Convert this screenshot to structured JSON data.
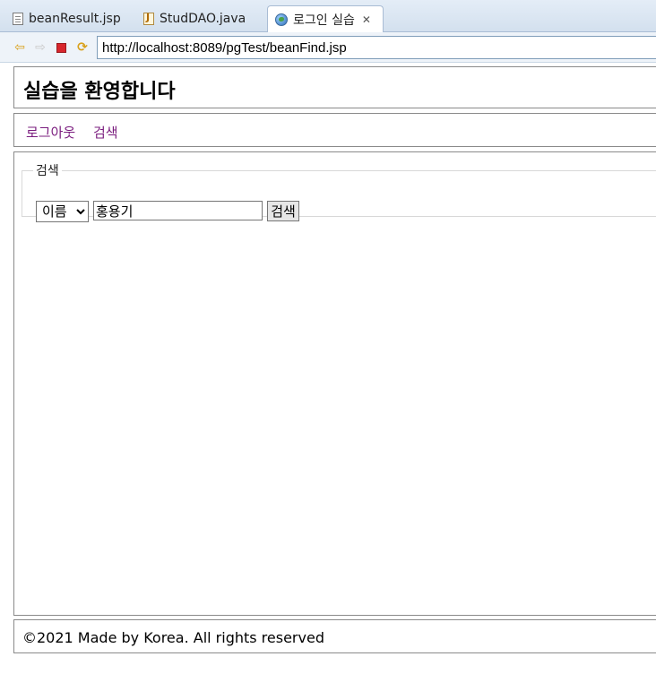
{
  "tabs": [
    {
      "label": "beanResult.jsp",
      "icon": "document-icon",
      "active": false
    },
    {
      "label": "StudDAO.java",
      "icon": "java-file-icon",
      "active": false
    },
    {
      "label": "로그인 실습",
      "icon": "globe-icon",
      "active": true,
      "close": "✕"
    }
  ],
  "navbar": {
    "url": "http://localhost:8089/pgTest/beanFind.jsp",
    "back_icon": "⇦",
    "forward_icon": "⇨",
    "refresh_icon": "⟳"
  },
  "header": {
    "title": "실습을 환영합니다"
  },
  "menu": {
    "logout": "로그아웃",
    "search": "검색",
    "link_color": "#7a1c7e"
  },
  "search": {
    "legend": "검색",
    "select_value": "이름",
    "input_value": "홍용기",
    "button_label": "검색"
  },
  "footer": {
    "text": "©2021 Made by Korea. All rights reserved"
  }
}
